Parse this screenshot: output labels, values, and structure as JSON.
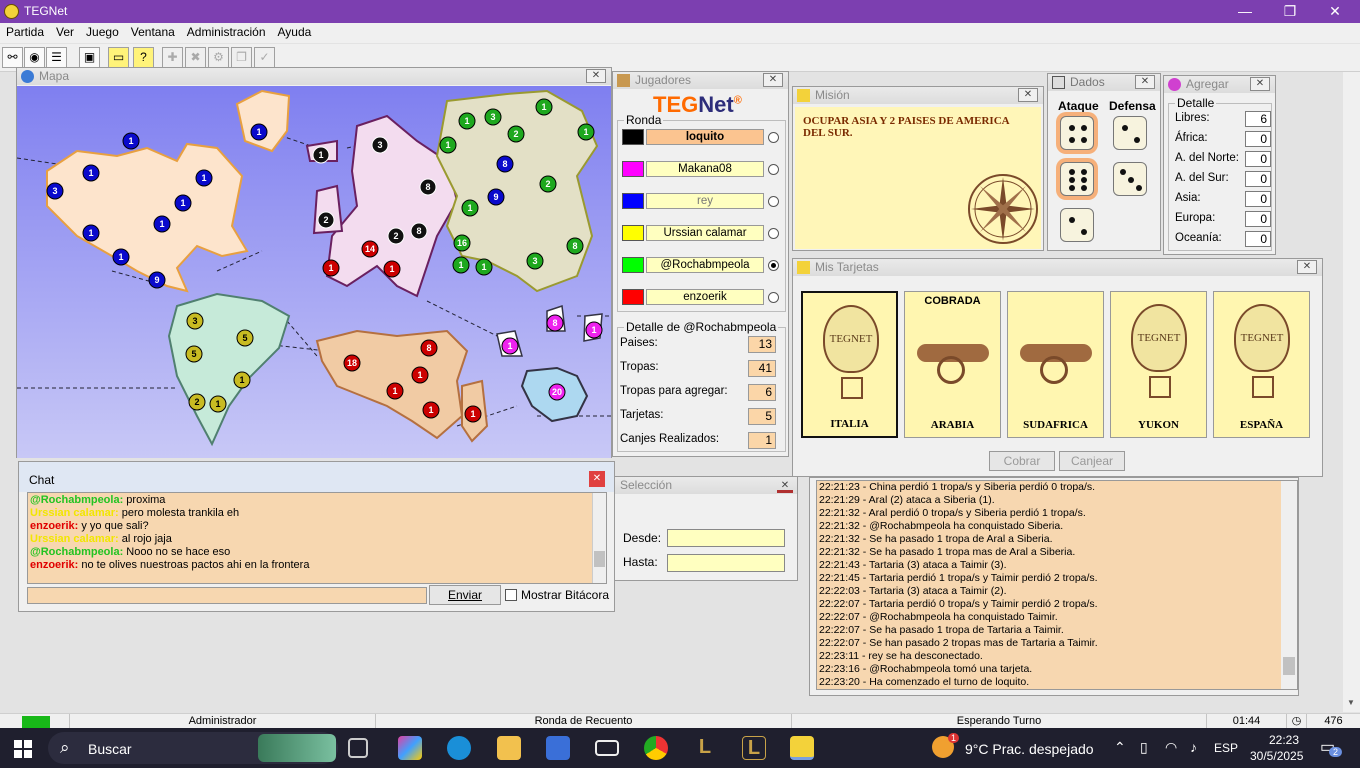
{
  "app": {
    "title": "TEGNet"
  },
  "window_buttons": {
    "min": "—",
    "max": "❐",
    "close": "✕"
  },
  "menu": [
    "Partida",
    "Ver",
    "Juego",
    "Ventana",
    "Administración",
    "Ayuda"
  ],
  "map": {
    "title": "Mapa"
  },
  "players": {
    "title": "Jugadores",
    "logo_left": "TEG",
    "logo_right": "Net",
    "logo_mark": "®",
    "ronda_label": "Ronda",
    "list": [
      {
        "name": "loquito",
        "color": "#000000",
        "active": true,
        "selected": false
      },
      {
        "name": "Makana08",
        "color": "#ff00ff",
        "active": false,
        "selected": false
      },
      {
        "name": "rey",
        "color": "#0000ff",
        "active": false,
        "selected": false,
        "dim": true
      },
      {
        "name": "Urssian calamar",
        "color": "#ffff00",
        "active": false,
        "selected": false
      },
      {
        "name": "@Rochabmpeola",
        "color": "#00ff00",
        "active": false,
        "selected": true
      },
      {
        "name": "enzoerik",
        "color": "#ff0000",
        "active": false,
        "selected": false
      }
    ],
    "detail_label": "Detalle de @Rochabmpeola",
    "detail": [
      {
        "label": "Paises:",
        "value": "13"
      },
      {
        "label": "Tropas:",
        "value": "41"
      },
      {
        "label": "Tropas para agregar:",
        "value": "6"
      },
      {
        "label": "Tarjetas:",
        "value": "5"
      },
      {
        "label": "Canjes Realizados:",
        "value": "1"
      }
    ]
  },
  "mision": {
    "title": "Misión",
    "text": "OCUPAR ASIA Y 2 PAISES DE AMERICA DEL SUR."
  },
  "dados": {
    "title": "Dados",
    "attack": "Ataque",
    "defense": "Defensa",
    "attack_dice": [
      4,
      6,
      2
    ],
    "defense_dice": [
      2,
      3
    ]
  },
  "agregar": {
    "title": "Agregar",
    "detalle": "Detalle",
    "rows": [
      {
        "label": "Libres:",
        "value": "6"
      },
      {
        "label": "África:",
        "value": "0"
      },
      {
        "label": "A. del Norte:",
        "value": "0"
      },
      {
        "label": "A. del Sur:",
        "value": "0"
      },
      {
        "label": "Asia:",
        "value": "0"
      },
      {
        "label": "Europa:",
        "value": "0"
      },
      {
        "label": "Oceanía:",
        "value": "0"
      }
    ]
  },
  "tarjetas": {
    "title": "Mis Tarjetas",
    "cobrada": "COBRADA",
    "cards": [
      {
        "name": "ITALIA",
        "art": "balloon"
      },
      {
        "name": "ARABIA",
        "art": "cannon"
      },
      {
        "name": "SUDAFRICA",
        "art": "cannon"
      },
      {
        "name": "YUKON",
        "art": "balloon"
      },
      {
        "name": "ESPAÑA",
        "art": "balloon"
      }
    ],
    "balloon_text": "TEGNET",
    "cobrar": "Cobrar",
    "canjear": "Canjear"
  },
  "chat": {
    "title": "Chat",
    "messages": [
      {
        "user": "@Rochabmpeola:",
        "text": "proxima",
        "color": "#22c322"
      },
      {
        "user": "Urssian calamar:",
        "text": "pero molesta trankila eh",
        "color": "#f2e600"
      },
      {
        "user": "enzoerik:",
        "text": "y yo que sali?",
        "color": "#e00000"
      },
      {
        "user": "Urssian calamar:",
        "text": "al rojo jaja",
        "color": "#f2e600"
      },
      {
        "user": "@Rochabmpeola:",
        "text": "Nooo no se hace eso",
        "color": "#22c322"
      },
      {
        "user": "enzoerik:",
        "text": "no te olives nuestroas pactos ahi en la frontera",
        "color": "#e00000"
      }
    ],
    "send": "Enviar",
    "show_log": "Mostrar Bitácora"
  },
  "seleccion": {
    "title": "Selección",
    "desde": "Desde:",
    "hasta": "Hasta:"
  },
  "log": [
    "22:21:23 - China perdió 1 tropa/s y Siberia perdió 0 tropa/s.",
    "22:21:29 - Aral (2) ataca a Siberia (1).",
    "22:21:32 - Aral perdió 0 tropa/s y Siberia perdió 1 tropa/s.",
    "22:21:32 - @Rochabmpeola ha conquistado Siberia.",
    "22:21:32 - Se ha pasado 1 tropa de Aral a Siberia.",
    "22:21:32 - Se ha pasado 1 tropa mas de Aral a Siberia.",
    "22:21:43 - Tartaria (3) ataca a Taimir (3).",
    "22:21:45 - Tartaria perdió 1 tropa/s y Taimir perdió 2 tropa/s.",
    "22:22:03 - Tartaria (3) ataca a Taimir (2).",
    "22:22:07 - Tartaria perdió 0 tropa/s y Taimir perdió 2 tropa/s.",
    "22:22:07 - @Rochabmpeola ha conquistado Taimir.",
    "22:22:07 - Se ha pasado 1 tropa de Tartaria a Taimir.",
    "22:22:07 - Se han pasado 2 tropas mas de Tartaria a Taimir.",
    "22:23:11 - rey se ha desconectado.",
    "22:23:16 - @Rochabmpeola tomó una tarjeta.",
    "22:23:20 - Ha comenzado el turno de loquito."
  ],
  "status": {
    "user": "Administrador",
    "phase": "Ronda de Recuento",
    "state": "Esperando Turno",
    "time": "01:44",
    "count": "476"
  },
  "taskbar": {
    "search": "Buscar",
    "weather": "9°C  Prac. despejado",
    "weather_badge": "1",
    "lang": "ESP",
    "time": "22:23",
    "date": "30/5/2025",
    "notif": "2"
  }
}
